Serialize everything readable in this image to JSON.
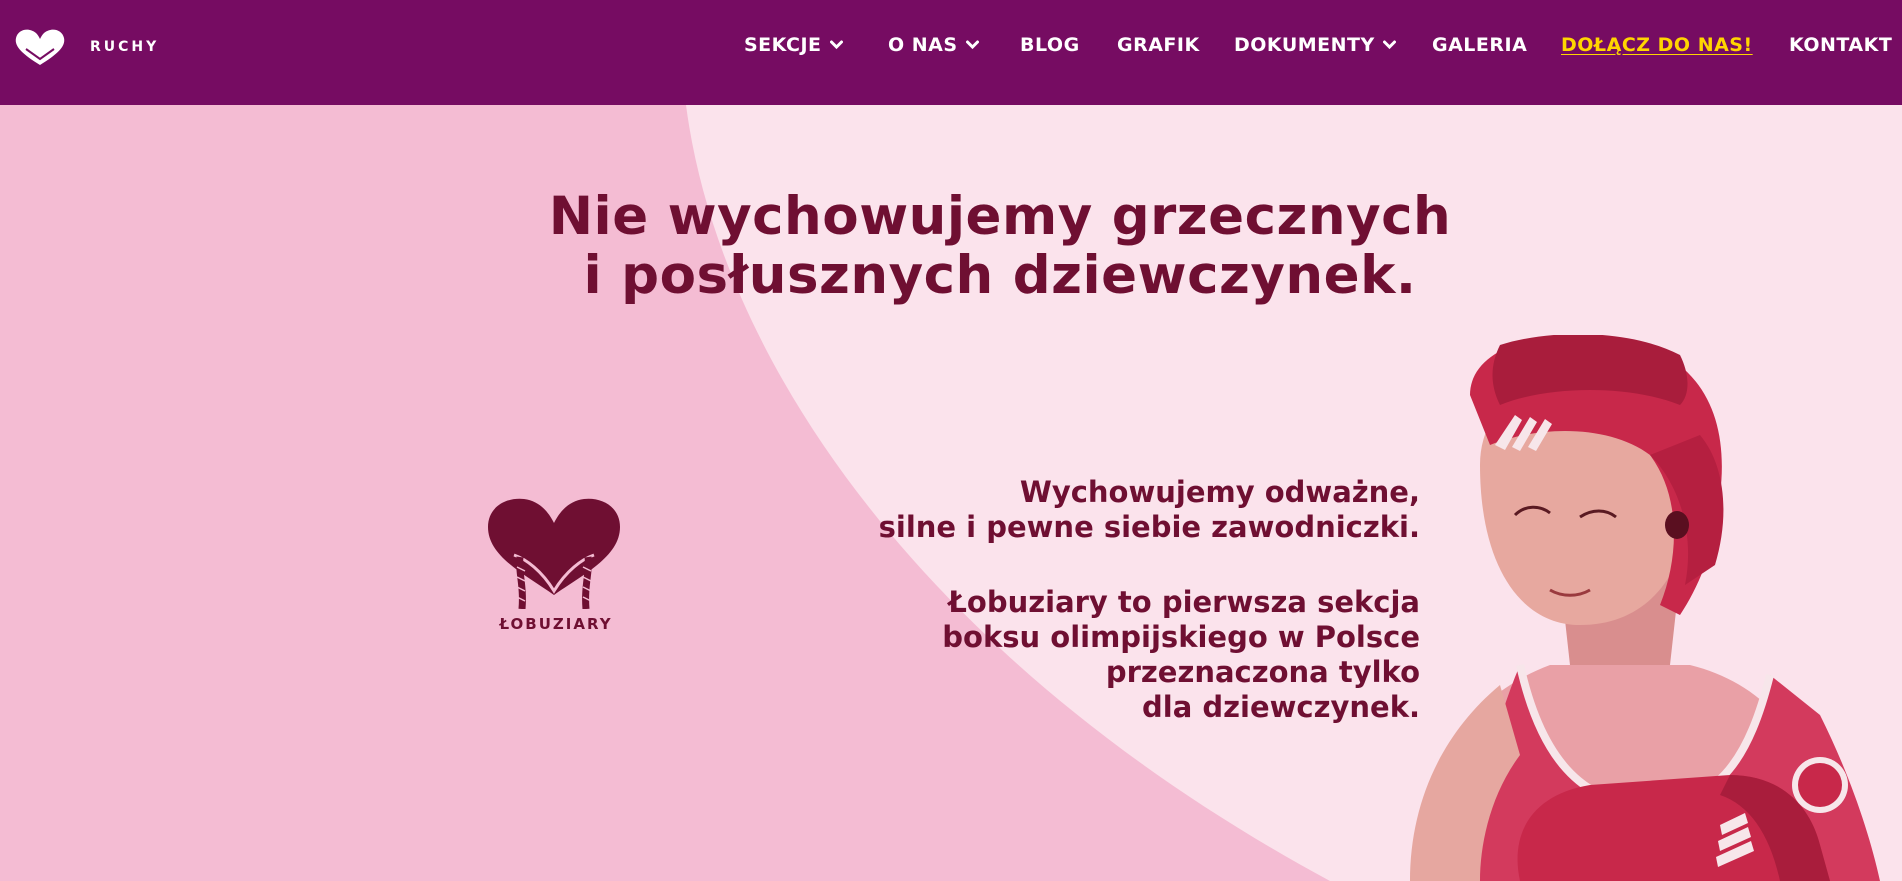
{
  "header": {
    "logo_text": "RUCHY",
    "logo_icon": "heart-gloves-icon",
    "nav": [
      {
        "label": "SEKCJE",
        "has_dropdown": true
      },
      {
        "label": "O NAS",
        "has_dropdown": true
      },
      {
        "label": "BLOG",
        "has_dropdown": false
      },
      {
        "label": "GRAFIK",
        "has_dropdown": false
      },
      {
        "label": "DOKUMENTY",
        "has_dropdown": true
      },
      {
        "label": "GALERIA",
        "has_dropdown": false
      },
      {
        "label": "DOŁĄCZ DO NAS!",
        "has_dropdown": false,
        "highlight": true
      },
      {
        "label": "KONTAKT",
        "has_dropdown": false
      }
    ]
  },
  "hero": {
    "headline": [
      "Nie wychowujemy grzecznych",
      "i posłusznych dziewczynek."
    ],
    "paragraph1": [
      "Wychowujemy odważne,",
      "silne i pewne siebie zawodniczki."
    ],
    "paragraph2": [
      "Łobuziary to pierwsza sekcja",
      "boksu olimpijskiego w Polsce",
      "przeznaczona tylko",
      "dla dziewczynek."
    ],
    "section_logo_text": "ŁOBUZIARY",
    "image": "boxer-girl-photo"
  },
  "colors": {
    "nav_bg": "#760c62",
    "accent_yellow": "#ffd500",
    "hero_pink": "#f4bcd3",
    "hero_light": "#fbe3ec",
    "text_maroon": "#6f0f32"
  }
}
